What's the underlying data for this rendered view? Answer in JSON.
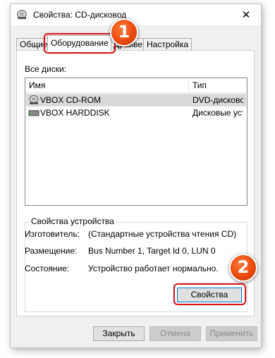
{
  "window": {
    "title": "Свойства: CD-дисковод",
    "close_glyph": "✕"
  },
  "tabs": [
    {
      "label": "Общие"
    },
    {
      "label": "Оборудование"
    },
    {
      "label": "Драйвер"
    },
    {
      "label": "Настройка"
    }
  ],
  "devices": {
    "label": "Все диски:",
    "columns": [
      "Имя",
      "Тип"
    ],
    "rows": [
      {
        "name": "VBOX CD-ROM",
        "type": "DVD-дисководы",
        "icon": "cd-drive-icon",
        "selected": true
      },
      {
        "name": "VBOX HARDDISK",
        "type": "Дисковые устройства",
        "icon": "hard-disk-icon",
        "selected": false
      }
    ]
  },
  "properties": {
    "title": "Свойства устройства",
    "manufacturer_label": "Изготовитель:",
    "manufacturer_value": "(Стандартные устройства чтения CD)",
    "location_label": "Размещение:",
    "location_value": "Bus Number 1, Target Id 0, LUN 0",
    "status_label": "Состояние:",
    "status_value": "Устройство работает нормально.",
    "properties_button": "Свойства"
  },
  "footer": {
    "close_button": "Закрыть",
    "cancel_button": "Отмена",
    "apply_button": "Применить"
  },
  "annotations": {
    "badge_1": "1",
    "badge_2": "2",
    "color": "#e0121e"
  }
}
